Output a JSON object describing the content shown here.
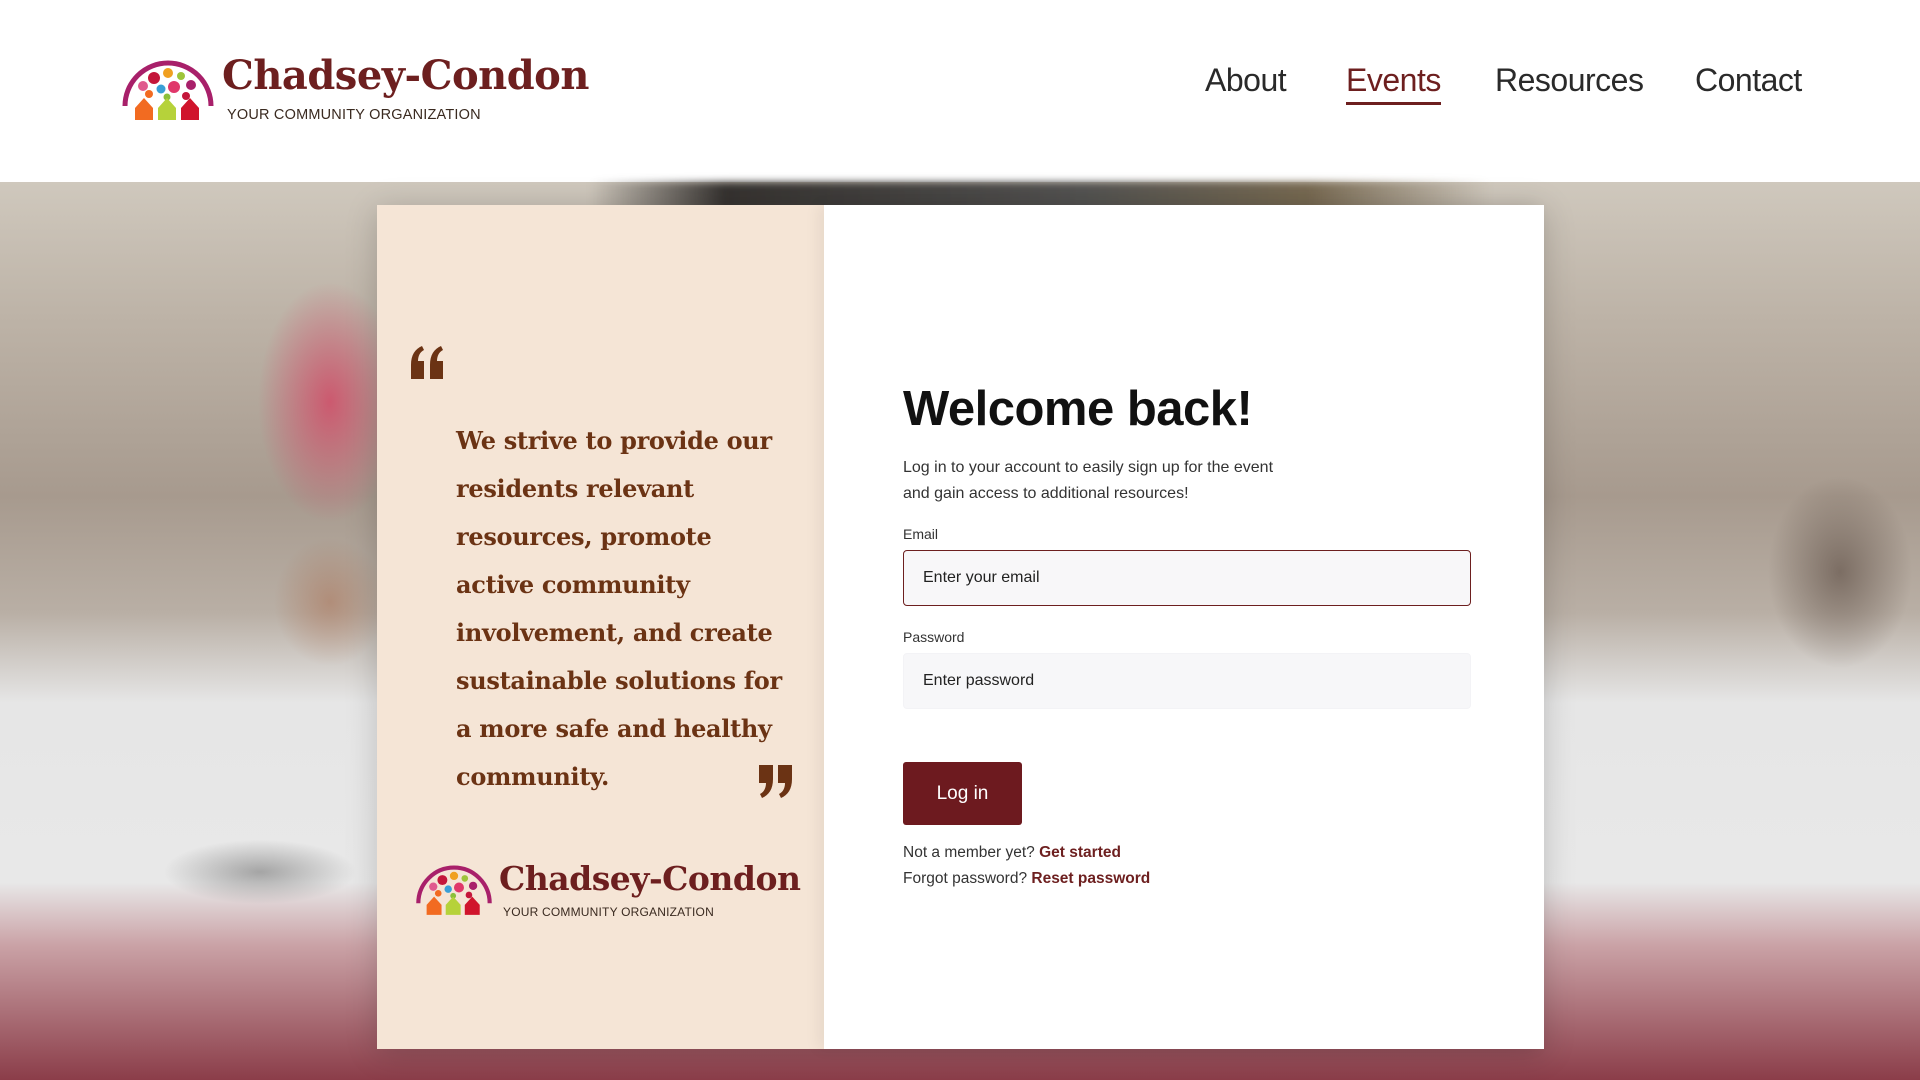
{
  "brand": {
    "name": "Chadsey-Condon",
    "tagline": "YOUR COMMUNITY ORGANIZATION"
  },
  "nav": {
    "items": [
      {
        "label": "About",
        "active": false
      },
      {
        "label": "Events",
        "active": true
      },
      {
        "label": "Resources",
        "active": false
      },
      {
        "label": "Contact",
        "active": false
      }
    ]
  },
  "quote": {
    "text": "We strive to provide our residents relevant resources, promote active community involvement, and create sustainable solutions for a more safe and healthy community."
  },
  "modal": {
    "title": "Welcome back!",
    "subtitle_line1": "Log in to your account to easily sign up for the event",
    "subtitle_line2": "and gain access to additional resources!",
    "email_label": "Email",
    "email_placeholder": "Enter your email",
    "password_label": "Password",
    "password_placeholder": "Enter password",
    "login_button": "Log in",
    "signup_prompt": "Not a member yet?",
    "signup_link": "Get started",
    "forgot_prompt": "Forgot password?",
    "reset_link": "Reset password",
    "close_icon": "close-icon"
  },
  "colors": {
    "brand_maroon": "#6d1f1f",
    "quote_brown": "#6b3314",
    "left_panel_bg": "#f5e5d6",
    "button_bg": "#6d1a1f"
  }
}
